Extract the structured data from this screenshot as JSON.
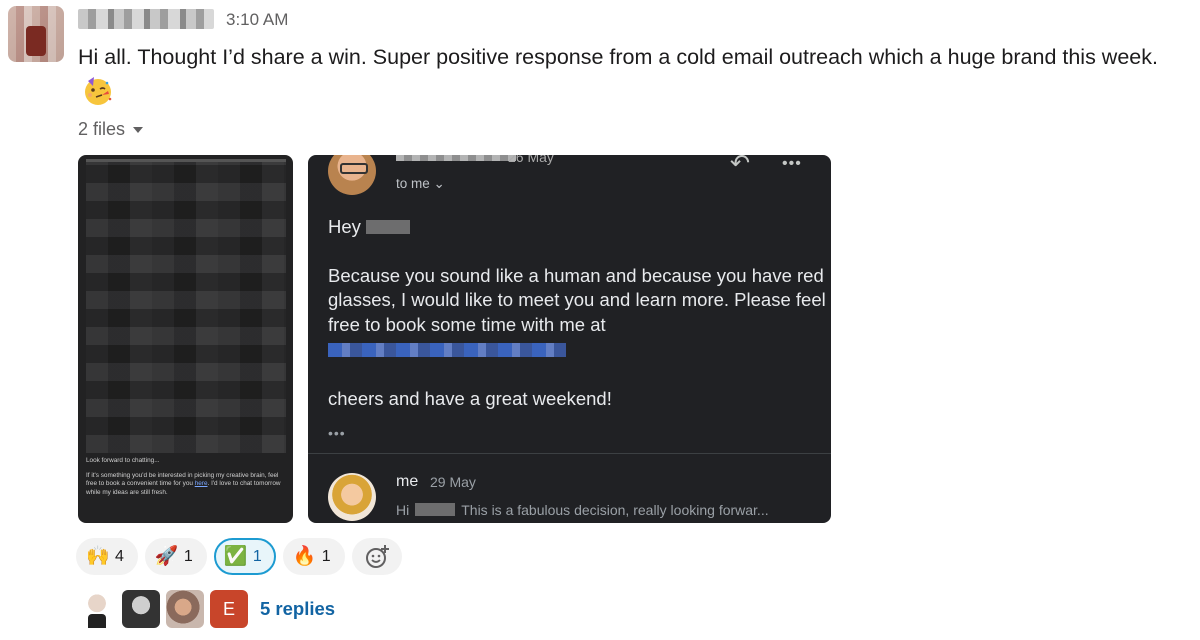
{
  "message": {
    "timestamp": "3:10 AM",
    "text": "Hi all. Thought I’d share a win. Super positive response from a cold email outreach which a huge brand this week.",
    "emoji": "partying-face"
  },
  "files": {
    "toggle_label": "2 files"
  },
  "attachment1": {
    "line1": "Look forward to chatting...",
    "line2_pre": "If it's something you'd be interested in picking my creative brain, feel free to book a convenient time for you ",
    "line2_link": "here",
    "line2_post": ". I'd love to chat tomorrow while my ideas are still fresh."
  },
  "attachment2": {
    "header_date": "26 May",
    "to_label": "to me ⌄",
    "greeting": "Hey",
    "paragraph": "Because you sound like a human and because you have red glasses, I would like to meet you and learn more. Please feel free to book some time with me at",
    "signoff": "cheers and have a great weekend!",
    "ellipsis": "•••",
    "reply_sender": "me",
    "reply_date": "29 May",
    "reply_snippet_pre": "Hi",
    "reply_snippet": "This is a fabulous decision, really looking forwar..."
  },
  "reactions": [
    {
      "emoji": "🙌",
      "name": "raised-hands",
      "count": "4",
      "active": false
    },
    {
      "emoji": "🚀",
      "name": "rocket",
      "count": "1",
      "active": false
    },
    {
      "emoji": "✅",
      "name": "white-check-mark",
      "count": "1",
      "active": true
    },
    {
      "emoji": "🔥",
      "name": "fire",
      "count": "1",
      "active": false
    }
  ],
  "thread": {
    "avatar4_letter": "E",
    "replies_label": "5 replies"
  },
  "colors": {
    "link": "#1264a3",
    "active_reaction_border": "#1d9bd1",
    "email_bg": "#202124"
  }
}
